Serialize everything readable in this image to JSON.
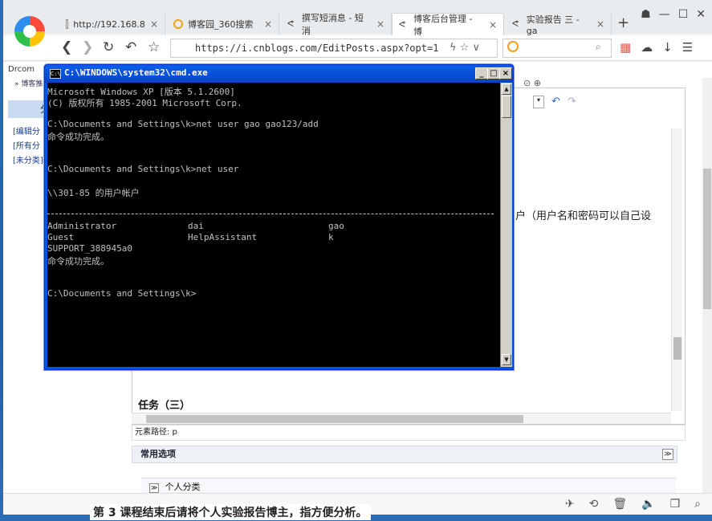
{
  "browser": {
    "tabs": [
      {
        "label": "http://192.168.8",
        "icon": "page-icon"
      },
      {
        "label": "博客园_360搜索",
        "icon": "so360-icon"
      },
      {
        "label": "撰写短消息 - 短消",
        "icon": "cnblogs-icon"
      },
      {
        "label": "博客后台管理 - 博",
        "icon": "cnblogs-icon",
        "active": true
      },
      {
        "label": "实验报告 三 - ga",
        "icon": "cnblogs-icon"
      }
    ],
    "url": "https://i.cnblogs.com/EditPosts.aspx?opt=1",
    "bookmark": "Drcom",
    "breadcrumb": "» 博客推",
    "left_head": "分",
    "left_links": [
      "[编辑分",
      "[所有分",
      "[未分类]"
    ]
  },
  "editor": {
    "text_fragment": "户（用户名和密码可以自己设",
    "task_title": "任务（三）",
    "path_label": "元素路径: p",
    "options_label": "常用选项",
    "category_label": "个人分类",
    "options_toggle": "≫",
    "category_toggle": "≫"
  },
  "peek_text": "第 3   课程结束后请将个人实验报告博主，指方便分析。",
  "cmd": {
    "title": "C:\\WINDOWS\\system32\\cmd.exe",
    "lines": [
      "Microsoft Windows XP [版本 5.1.2600]",
      "(C) 版权所有 1985-2001 Microsoft Corp.",
      "",
      "C:\\Documents and Settings\\k>net user gao gao123/add",
      "命令成功完成。",
      "",
      "",
      "C:\\Documents and Settings\\k>net user",
      "",
      "\\\\301-85 的用户帐户"
    ],
    "users": [
      [
        "Administrator",
        "dai",
        "gao"
      ],
      [
        "Guest",
        "HelpAssistant",
        "k"
      ],
      [
        "SUPPORT_388945a0",
        "",
        ""
      ]
    ],
    "after_lines": [
      "命令成功完成。",
      "",
      "",
      "C:\\Documents and Settings\\k>"
    ]
  }
}
